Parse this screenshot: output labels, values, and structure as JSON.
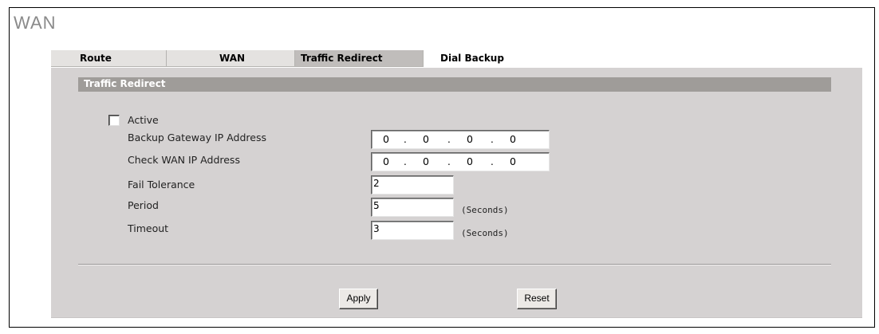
{
  "page": {
    "title": "WAN"
  },
  "tabs": [
    {
      "label": "Route"
    },
    {
      "label": "WAN"
    },
    {
      "label": "Traffic Redirect",
      "active": true
    },
    {
      "label": "Dial Backup"
    }
  ],
  "section": {
    "title": "Traffic Redirect"
  },
  "form": {
    "active": {
      "label": "Active",
      "checked": false
    },
    "backup_gateway": {
      "label": "Backup Gateway IP Address",
      "octets": [
        "0",
        "0",
        "0",
        "0"
      ]
    },
    "check_wan": {
      "label": "Check WAN IP Address",
      "octets": [
        "0",
        "0",
        "0",
        "0"
      ]
    },
    "fail_tolerance": {
      "label": "Fail Tolerance",
      "value": "2"
    },
    "period": {
      "label": "Period",
      "value": "5",
      "unit": "(Seconds)"
    },
    "timeout": {
      "label": "Timeout",
      "value": "3",
      "unit": "(Seconds)"
    }
  },
  "buttons": {
    "apply": "Apply",
    "reset": "Reset"
  },
  "colors": {
    "panel": "#d5d2d2",
    "section_bar": "#9f9c99",
    "active_tab": "#c0bdbb",
    "title": "#8a8a8a"
  }
}
